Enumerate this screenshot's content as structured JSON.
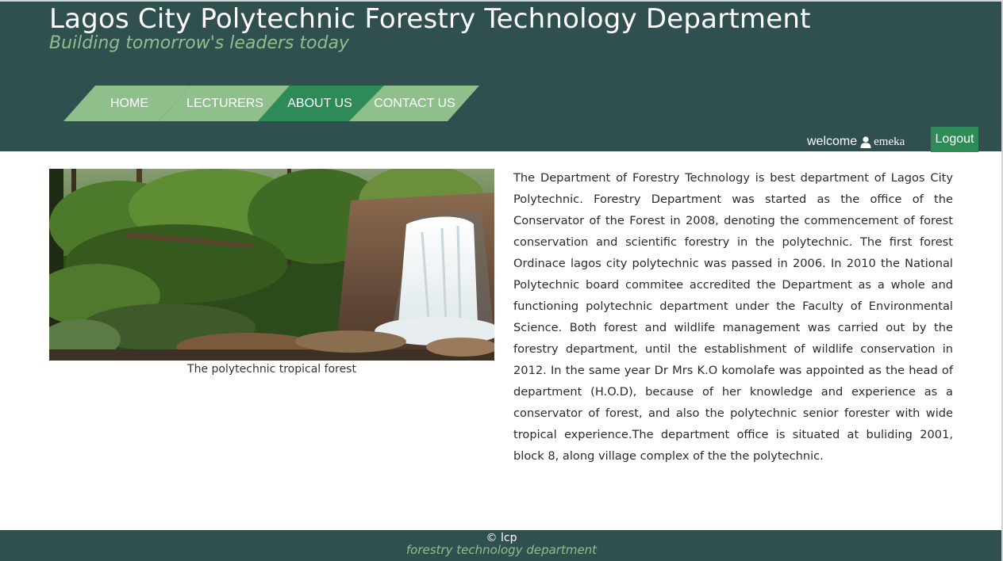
{
  "header": {
    "title": "Lagos City Polytechnic Forestry Technology Department",
    "tagline": "Building tomorrow's leaders today"
  },
  "nav": {
    "items": [
      {
        "label": "HOME"
      },
      {
        "label": "LECTURERS"
      },
      {
        "label": "ABOUT US",
        "active": true
      },
      {
        "label": "CONTACT US"
      }
    ]
  },
  "user": {
    "welcome_label": "welcome",
    "username": "emeka",
    "logout_label": "Logout"
  },
  "content": {
    "image_icon": "forest-waterfall-photo",
    "caption": "The polytechnic tropical forest",
    "about": "The Department of Forestry Technology is best department of Lagos City Polytechnic. Forestry Department was started as the office of the Conservator of the Forest in 2008, denoting the commencement of forest conservation and scientific forestry in the polytechnic. The first forest Ordinace lagos city polytechnic was passed in 2006. In 2010 the National Polytechnic board commitee accredited the Department as a whole and functioning polytechnic department under the Faculty of Environmental Science. Both forest and wildlife management was carried out by the forestry department, until the establishment of wildlife conservation in 2012. In the same year Dr Mrs K.O komolafe was appointed as the head of department (H.O.D), because of her knowledge and experience as a conservator of forest, and also the polytechnic senior forester with wide tropical experience.The department office is situated at buliding 2001, block 8, along village complex of the the polytechnic."
  },
  "footer": {
    "copyright": "© lcp",
    "department": "forestry technology department"
  },
  "colors": {
    "header_bg": "#2f504f",
    "nav_light": "#8fbf8a",
    "nav_active": "#2e8b57",
    "tagline": "#8fbf8a"
  }
}
